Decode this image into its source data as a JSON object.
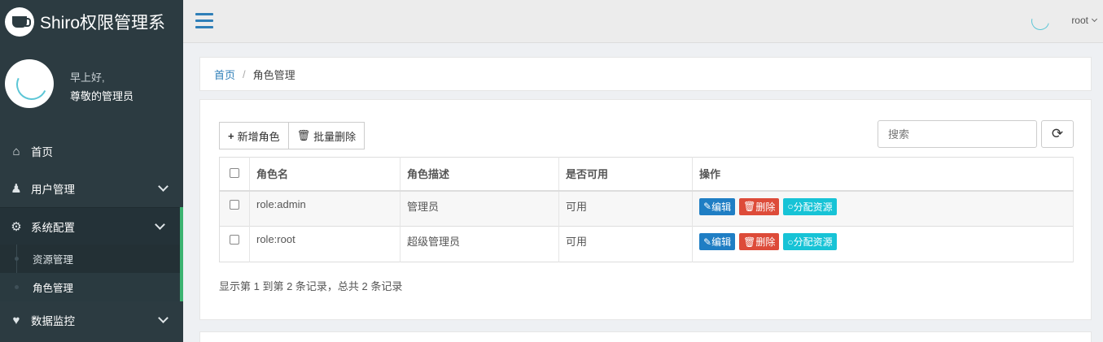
{
  "brand": {
    "title": "Shiro权限管理系"
  },
  "user_panel": {
    "greeting": "早上好,",
    "role": "尊敬的管理员"
  },
  "menu": {
    "items": [
      {
        "label": "首页",
        "icon": "home-icon"
      },
      {
        "label": "用户管理",
        "icon": "users-icon"
      },
      {
        "label": "系统配置",
        "icon": "cogs-icon"
      },
      {
        "label": "数据监控",
        "icon": "heartbeat-icon"
      }
    ],
    "sub_items": [
      {
        "label": "资源管理"
      },
      {
        "label": "角色管理"
      }
    ]
  },
  "topbar": {
    "username": "root"
  },
  "breadcrumb": {
    "home": "首页",
    "separator": "/",
    "current": "角色管理"
  },
  "toolbar": {
    "add_label": "新增角色",
    "batch_delete_label": "批量删除",
    "search_placeholder": "搜索"
  },
  "table": {
    "columns": [
      "角色名",
      "角色描述",
      "是否可用",
      "操作"
    ],
    "rows": [
      {
        "name": "role:admin",
        "desc": "管理员",
        "enabled": "可用"
      },
      {
        "name": "role:root",
        "desc": "超级管理员",
        "enabled": "可用"
      }
    ],
    "actions": {
      "edit": "编辑",
      "delete": "删除",
      "assign": "分配资源"
    }
  },
  "pagination": {
    "summary": "显示第 1 到第 2 条记录，总共 2 条记录"
  },
  "colors": {
    "sidebar_bg": "#2c3b41",
    "accent_blue": "#2f7fb8",
    "edit": "#1f7ec4",
    "delete": "#dd4b39",
    "assign": "#17c3d6",
    "active_indicator": "#3cb371"
  }
}
